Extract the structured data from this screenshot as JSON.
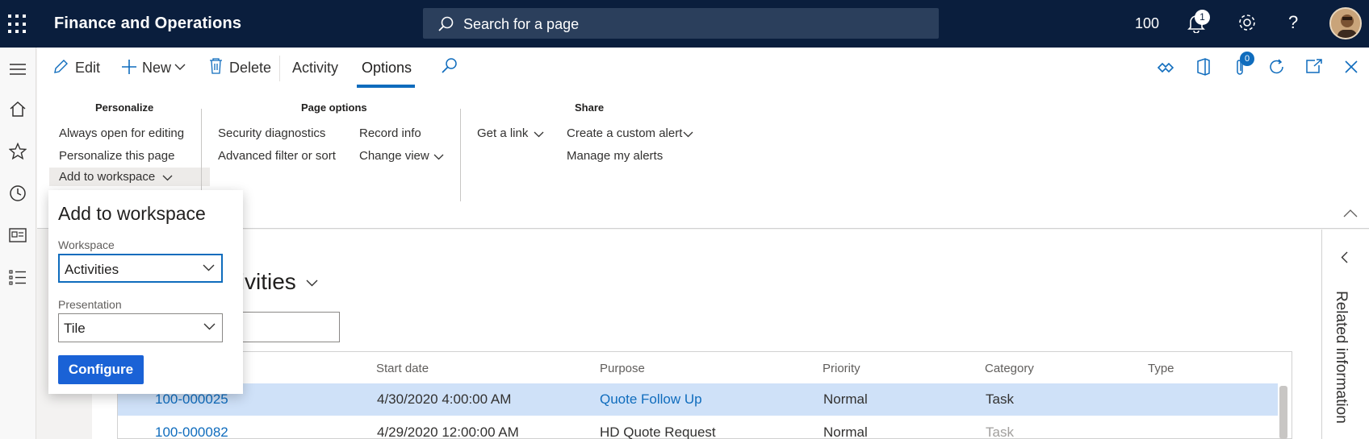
{
  "header": {
    "app_title": "Finance and Operations",
    "search_placeholder": "Search for a page",
    "company": "100",
    "notification_count": "1"
  },
  "actionbar": {
    "edit": "Edit",
    "new": "New",
    "delete": "Delete",
    "activity": "Activity",
    "options": "Options",
    "attachments_count": "0"
  },
  "ribbon": {
    "personalize": {
      "title": "Personalize",
      "items": [
        "Always open for editing",
        "Personalize this page",
        "Add to workspace"
      ]
    },
    "page_options": {
      "title": "Page options",
      "col1": [
        "Security diagnostics",
        "Advanced filter or sort"
      ],
      "col2": [
        "Record info",
        "Change view"
      ]
    },
    "share": {
      "title": "Share",
      "get_link": "Get a link",
      "col2": [
        "Create a custom alert",
        "Manage my alerts"
      ]
    }
  },
  "flyout": {
    "title": "Add to workspace",
    "workspace_label": "Workspace",
    "workspace_value": "Activities",
    "presentation_label": "Presentation",
    "presentation_value": "Tile",
    "configure": "Configure"
  },
  "page": {
    "title": "ctivities"
  },
  "grid": {
    "columns": [
      "Start date",
      "Purpose",
      "Priority",
      "Category",
      "Type"
    ],
    "rows": [
      {
        "id": "100-000025",
        "start": "4/30/2020 4:00:00 AM",
        "purpose": "Quote Follow Up",
        "priority": "Normal",
        "category": "Task",
        "type": ""
      },
      {
        "id": "100-000082",
        "start": "4/29/2020 12:00:00 AM",
        "purpose": "HD Quote Request",
        "priority": "Normal",
        "category": "Task",
        "type": ""
      }
    ]
  },
  "related": {
    "label": "Related information"
  },
  "colors": {
    "topbar": "#0a1e3d",
    "accent": "#0f6cbd",
    "selected_row": "#cfe1f8",
    "button": "#1a62d6"
  }
}
